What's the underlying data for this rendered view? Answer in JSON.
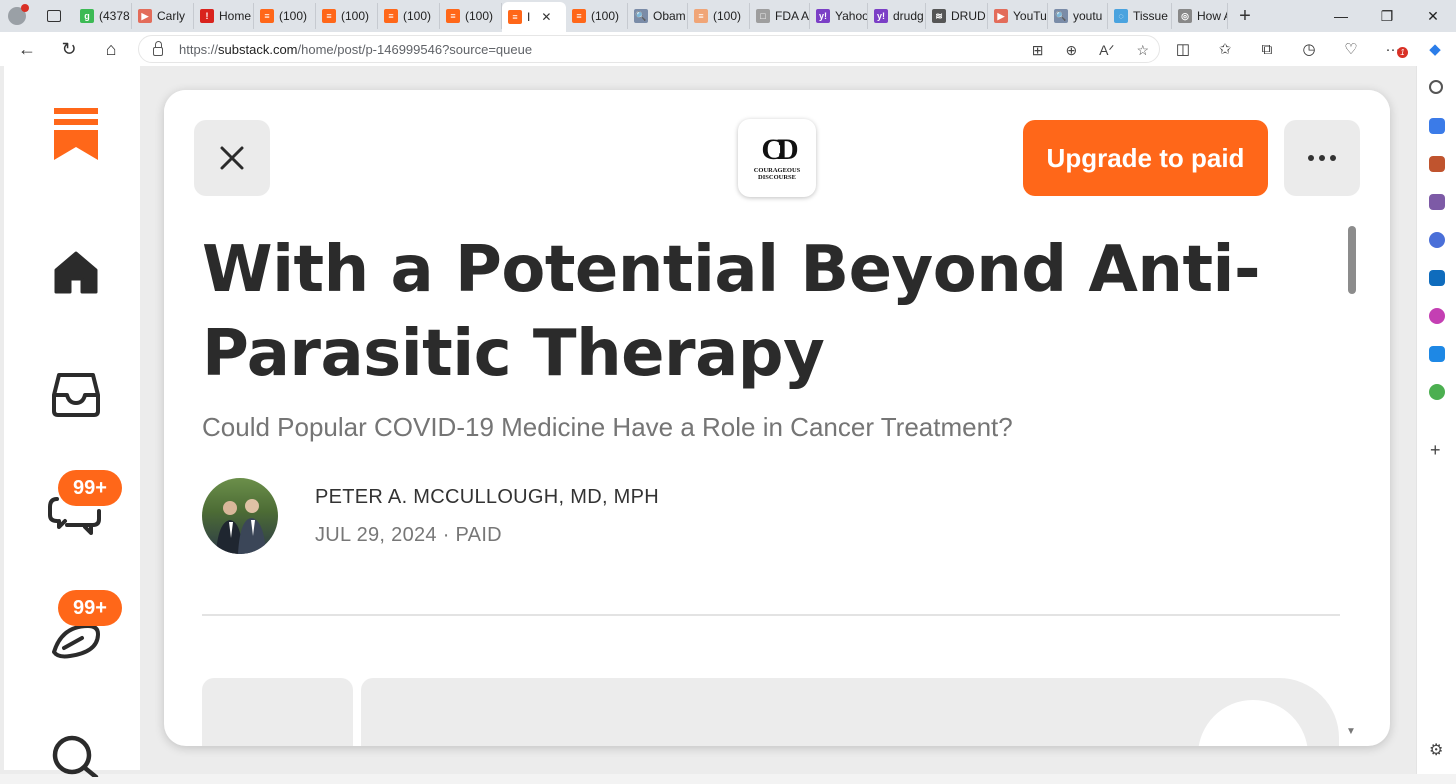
{
  "browser": {
    "tabs": [
      {
        "label": "(4378",
        "color": "#3cba54",
        "glyph": "g"
      },
      {
        "label": "Carly",
        "color": "#e36c5a",
        "glyph": "▶"
      },
      {
        "label": "Home",
        "color": "#d9231d",
        "glyph": "!"
      },
      {
        "label": "(100)",
        "color": "#ff6719",
        "glyph": "≡"
      },
      {
        "label": "(100)",
        "color": "#ff6719",
        "glyph": "≡"
      },
      {
        "label": "(100)",
        "color": "#ff6719",
        "glyph": "≡"
      },
      {
        "label": "(100)",
        "color": "#ff6719",
        "glyph": "≡"
      },
      {
        "label": "I",
        "color": "#ff6719",
        "glyph": "≡",
        "active": true
      },
      {
        "label": "(100)",
        "color": "#ff6719",
        "glyph": "≡"
      },
      {
        "label": "Obam",
        "color": "#7a8ca8",
        "glyph": "🔍"
      },
      {
        "label": "(100)",
        "color": "#f0a577",
        "glyph": "≡"
      },
      {
        "label": "FDA A",
        "color": "#9e9e9e",
        "glyph": "□"
      },
      {
        "label": "Yahoo",
        "color": "#7b3fc6",
        "glyph": "y!"
      },
      {
        "label": "drudg",
        "color": "#7b3fc6",
        "glyph": "y!"
      },
      {
        "label": "DRUD",
        "color": "#555555",
        "glyph": "≋"
      },
      {
        "label": "YouTu",
        "color": "#e36c5a",
        "glyph": "▶"
      },
      {
        "label": "youtu",
        "color": "#7a8ca8",
        "glyph": "🔍"
      },
      {
        "label": "Tissue",
        "color": "#4aa3df",
        "glyph": "◌"
      },
      {
        "label": "How A",
        "color": "#888888",
        "glyph": "◎"
      }
    ],
    "url_prefix": "https://",
    "url_domain": "substack.com",
    "url_path": "/home/post/p-146999546?source=queue",
    "notification_count": "1"
  },
  "left_nav": {
    "inbox_badge": "99+",
    "activity_badge": "99+",
    "brand_color": "#ff6719"
  },
  "post": {
    "publication": {
      "monogram": "CD",
      "name_line1": "COURAGEOUS",
      "name_line2": "DISCOURSE"
    },
    "upgrade_label": "Upgrade to paid",
    "title_line1": "With a Potential Beyond Anti-",
    "title_line2": "Parasitic Therapy",
    "subtitle": "Could Popular COVID-19 Medicine Have a Role in Cancer Treatment?",
    "author": "PETER A. MCCULLOUGH, MD, MPH",
    "date": "JUL 29, 2024",
    "access": "PAID"
  }
}
